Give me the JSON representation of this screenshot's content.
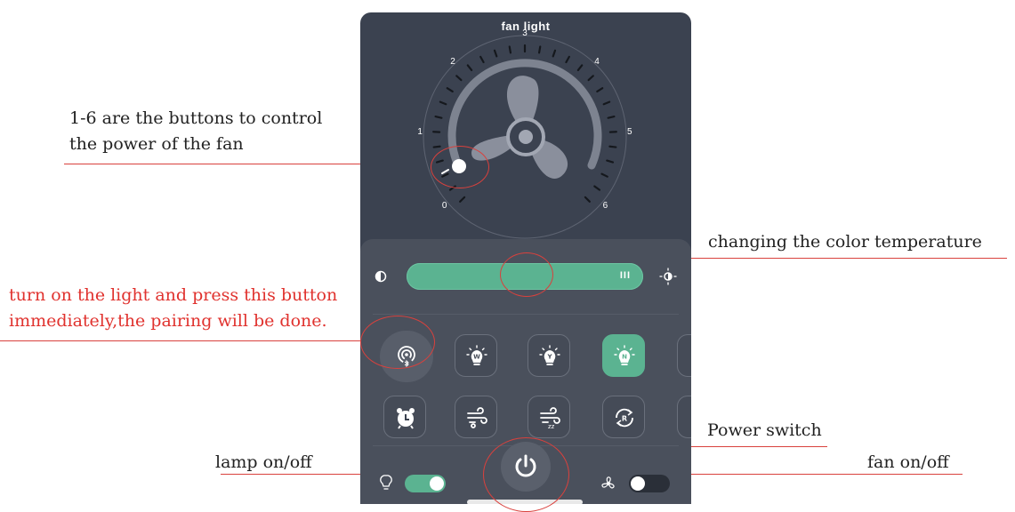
{
  "app": {
    "title": "fan light"
  },
  "dial": {
    "labels": [
      "0",
      "1",
      "2",
      "3",
      "4",
      "5",
      "6"
    ],
    "current_level": 0
  },
  "slider": {
    "grip_symbol": "III",
    "value_fraction": 0.6
  },
  "light_buttons": [
    {
      "letter": "W",
      "active": false
    },
    {
      "letter": "Y",
      "active": false
    },
    {
      "letter": "N",
      "active": true
    }
  ],
  "mode_buttons": [
    {
      "icon": "alarm-clock-icon"
    },
    {
      "icon": "wind-natural-icon"
    },
    {
      "icon": "wind-sleep-icon"
    },
    {
      "letter": "R",
      "icon": "reverse-icon"
    }
  ],
  "toggles": {
    "lamp": {
      "on": true
    },
    "fan": {
      "on": false
    }
  },
  "colors": {
    "accent": "#5bb391",
    "background": "#3b4250",
    "panel": "#4a505c",
    "annotation": "#d9413d"
  },
  "annotations": {
    "fan_power_line1": "1-6 are the buttons to control",
    "fan_power_line2": "the power of the fan",
    "color_temp": "changing the color temperature",
    "pairing_line1": "turn on the light and press this button",
    "pairing_line2": "immediately,the pairing will be done.",
    "power_switch": "Power switch",
    "lamp_toggle": "lamp  on/off",
    "fan_toggle": "fan on/off"
  }
}
